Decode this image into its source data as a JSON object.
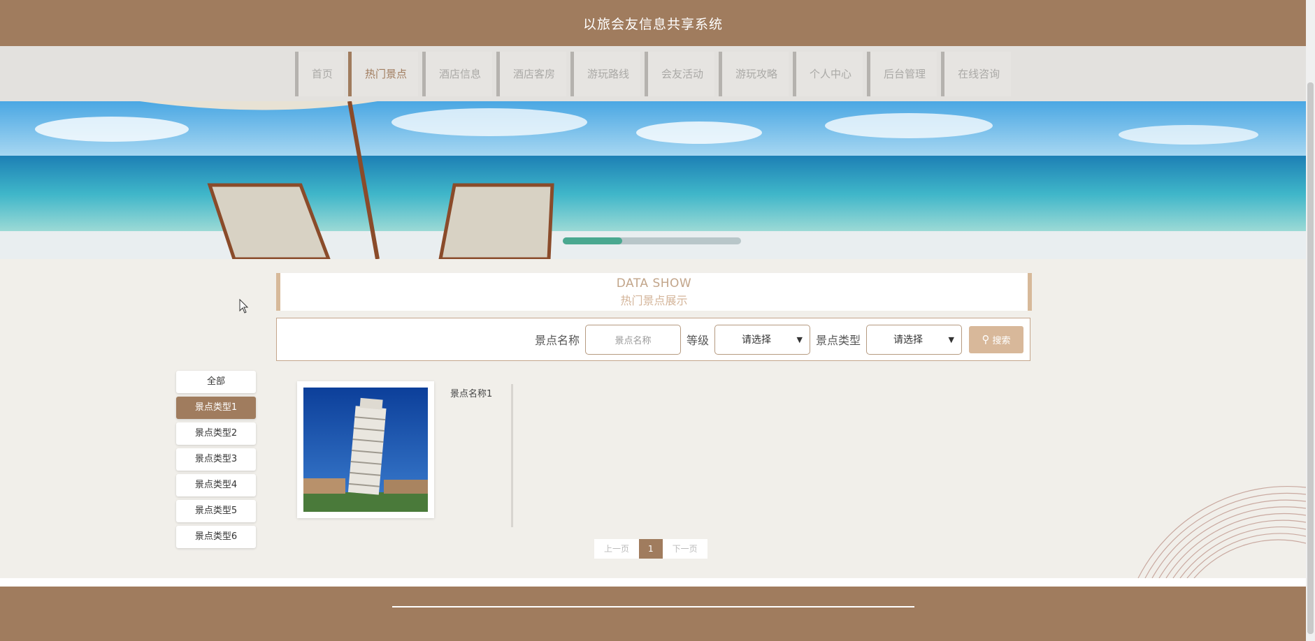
{
  "header": {
    "title": "以旅会友信息共享系统"
  },
  "nav": {
    "items": [
      "首页",
      "热门景点",
      "酒店信息",
      "酒店客房",
      "游玩路线",
      "会友活动",
      "游玩攻略",
      "个人中心",
      "后台管理",
      "在线咨询"
    ],
    "active_index": 1
  },
  "section": {
    "title_en": "DATA SHOW",
    "title_cn": "热门景点展示"
  },
  "search": {
    "name_label": "景点名称",
    "name_placeholder": "景点名称",
    "level_label": "等级",
    "level_value": "请选择",
    "type_label": "景点类型",
    "type_value": "请选择",
    "button_label": "搜索"
  },
  "categories": {
    "items": [
      "全部",
      "景点类型1",
      "景点类型2",
      "景点类型3",
      "景点类型4",
      "景点类型5",
      "景点类型6"
    ],
    "active_index": 1
  },
  "products": [
    {
      "name": "景点名称1",
      "image_icon": "leaning-tower-photo"
    }
  ],
  "pagination": {
    "prev": "上一页",
    "current": "1",
    "next": "下一页"
  },
  "colors": {
    "brand": "#a07c5e",
    "accent_light": "#d8b89a",
    "nav_bg": "#e3e1de"
  },
  "icons": {
    "search": "magnifier-icon"
  }
}
